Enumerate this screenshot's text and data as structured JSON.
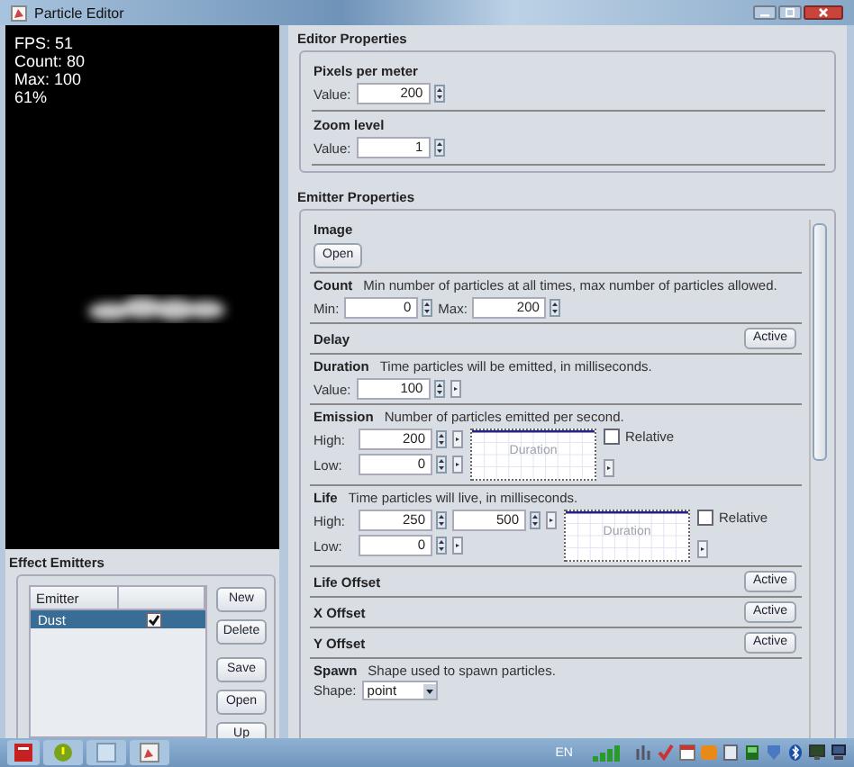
{
  "window": {
    "title": "Particle Editor"
  },
  "preview": {
    "stats": [
      "FPS: 51",
      "Count: 80",
      "Max: 100",
      "61%"
    ]
  },
  "effect_emitters": {
    "title": "Effect Emitters",
    "columns": [
      "Emitter"
    ],
    "rows": [
      {
        "name": "Dust",
        "checked": true,
        "selected": true
      }
    ],
    "buttons": [
      "New",
      "Delete",
      "Save",
      "Open",
      "Up"
    ]
  },
  "editor_properties": {
    "title": "Editor Properties",
    "groups": [
      {
        "label": "Pixels per meter",
        "value_label": "Value:",
        "value": "200"
      },
      {
        "label": "Zoom level",
        "value_label": "Value:",
        "value": "1"
      }
    ]
  },
  "emitter_properties": {
    "title": "Emitter Properties",
    "sections": [
      {
        "kind": "image",
        "title": "Image",
        "button": "Open"
      },
      {
        "kind": "range",
        "title": "Count",
        "description": "Min number of particles at all times, max number of particles allowed.",
        "fields": [
          {
            "label": "Min:",
            "value": "0"
          },
          {
            "label": "Max:",
            "value": "200"
          }
        ]
      },
      {
        "kind": "toggle",
        "title": "Delay",
        "button": "Active"
      },
      {
        "kind": "value",
        "title": "Duration",
        "description": "Time particles will be emitted, in milliseconds.",
        "fields": [
          {
            "label": "Value:",
            "value": "100"
          }
        ]
      },
      {
        "kind": "graph",
        "title": "Emission",
        "description": "Number of particles emitted per second.",
        "rows": [
          {
            "label": "High:",
            "values": [
              "200"
            ]
          },
          {
            "label": "Low:",
            "values": [
              "0"
            ]
          }
        ],
        "relative": {
          "label": "Relative",
          "checked": false
        },
        "graph_label": "Duration"
      },
      {
        "kind": "graph",
        "title": "Life",
        "description": "Time particles will live, in milliseconds.",
        "rows": [
          {
            "label": "High:",
            "values": [
              "250",
              "500"
            ]
          },
          {
            "label": "Low:",
            "values": [
              "0"
            ]
          }
        ],
        "relative": {
          "label": "Relative",
          "checked": false
        },
        "graph_label": "Duration"
      },
      {
        "kind": "toggle",
        "title": "Life Offset",
        "button": "Active"
      },
      {
        "kind": "toggle",
        "title": "X Offset",
        "button": "Active"
      },
      {
        "kind": "toggle",
        "title": "Y Offset",
        "button": "Active"
      },
      {
        "kind": "select",
        "title": "Spawn",
        "description": "Shape used to spawn particles.",
        "fields": [
          {
            "label": "Shape:",
            "value": "point"
          }
        ]
      }
    ]
  },
  "taskbar": {
    "language": "EN"
  }
}
